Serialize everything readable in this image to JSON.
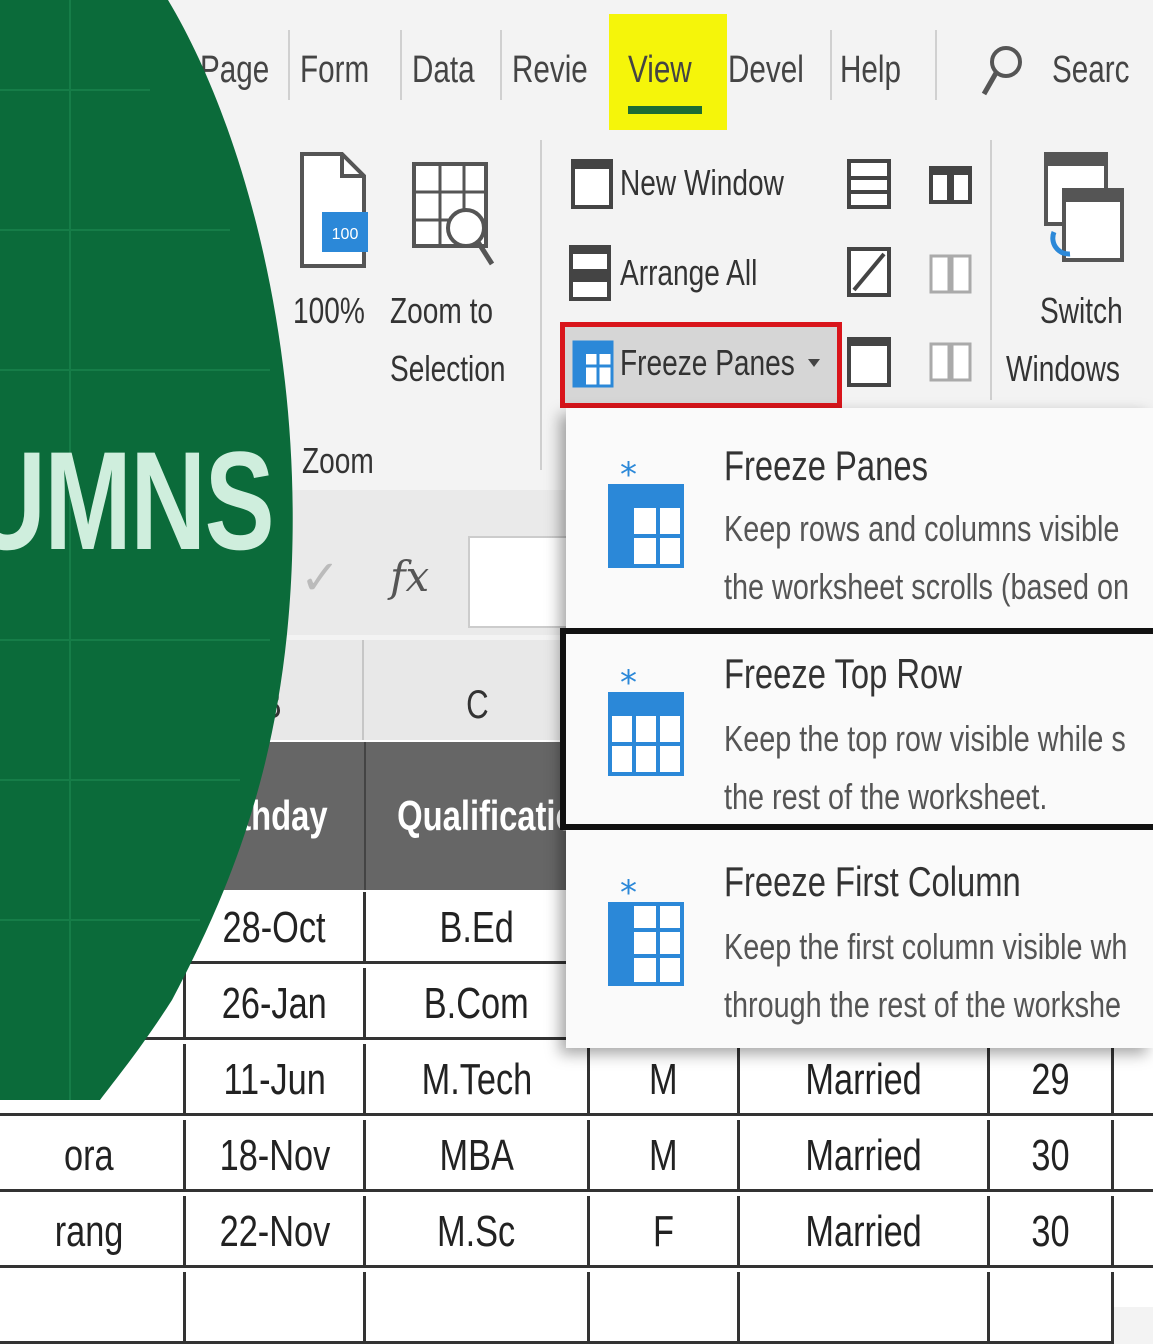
{
  "ribbon_tabs": [
    "Page",
    "Form",
    "Data",
    "Revie",
    "View",
    "Devel",
    "Help"
  ],
  "search_label": "Searc",
  "zoom_group": {
    "btn_100": "100%",
    "zoom_to_selection_line1": "Zoom to",
    "zoom_to_selection_line2": "Selection",
    "group_label": "Zoom"
  },
  "window_group": {
    "new_window": "New Window",
    "arrange_all": "Arrange All",
    "freeze_panes": "Freeze Panes",
    "switch_line1": "Switch",
    "switch_line2": "Windows"
  },
  "formula_bar": {
    "check": "✓",
    "fx": "fx"
  },
  "freeze_menu": [
    {
      "title": "Freeze Panes",
      "desc1": "Keep rows and columns visible",
      "desc2": "the worksheet scrolls (based on"
    },
    {
      "title": "Freeze Top Row",
      "desc1": "Keep the top row visible while s",
      "desc2": "the rest of the worksheet."
    },
    {
      "title": "Freeze First Column",
      "desc1": "Keep the first column visible wh",
      "desc2": "through the rest of the workshe"
    }
  ],
  "columns": [
    "B",
    "C"
  ],
  "header_row": {
    "col_a": "",
    "birthday": "irthday",
    "qualification": "Qualificatio"
  },
  "rows": [
    {
      "name": "",
      "birthday": "28-Oct",
      "qualification": "B.Ed",
      "gender": "",
      "status": "",
      "age": ""
    },
    {
      "name": "",
      "birthday": "26-Jan",
      "qualification": "B.Com",
      "gender": "",
      "status": "",
      "age": ""
    },
    {
      "name": "",
      "birthday": "11-Jun",
      "qualification": "M.Tech",
      "gender": "M",
      "status": "Married",
      "age": "29"
    },
    {
      "name": "ora",
      "birthday": "18-Nov",
      "qualification": "MBA",
      "gender": "M",
      "status": "Married",
      "age": "30"
    },
    {
      "name": "rang",
      "birthday": "22-Nov",
      "qualification": "M.Sc",
      "gender": "F",
      "status": "Married",
      "age": "30"
    }
  ],
  "overlay_text": "UMNS",
  "colors": {
    "green": "#0b6b3a",
    "highlight": "#f5f50a",
    "red_box": "#d9151b",
    "header_gray": "#666666"
  }
}
